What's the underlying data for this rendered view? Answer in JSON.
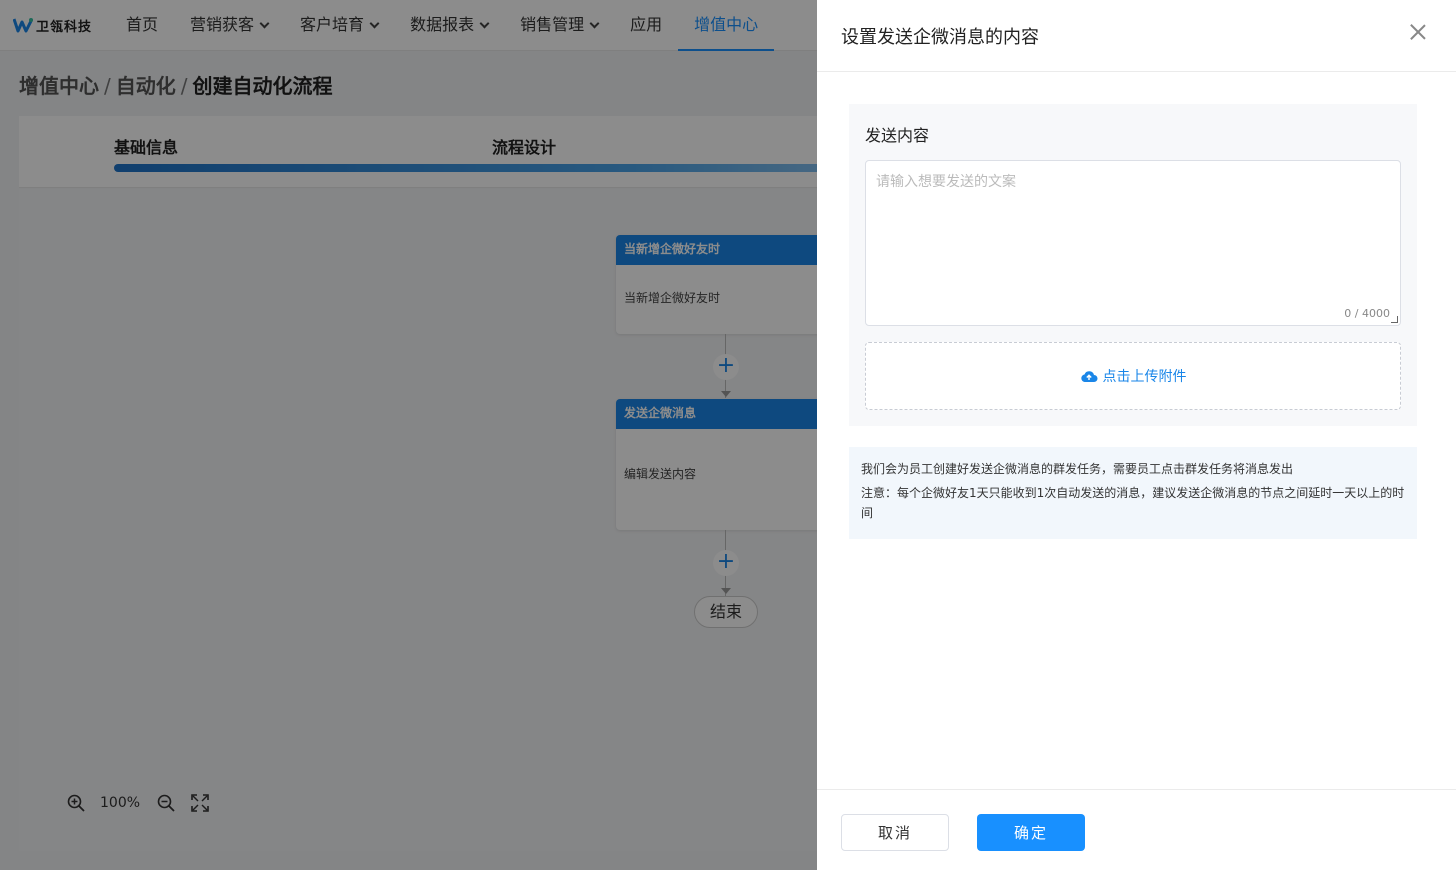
{
  "app": {
    "logo_text": "卫瓴科技"
  },
  "nav": {
    "items": [
      {
        "label": "首页",
        "has_dropdown": false,
        "active": false
      },
      {
        "label": "营销获客",
        "has_dropdown": true,
        "active": false
      },
      {
        "label": "客户培育",
        "has_dropdown": true,
        "active": false
      },
      {
        "label": "数据报表",
        "has_dropdown": true,
        "active": false
      },
      {
        "label": "销售管理",
        "has_dropdown": true,
        "active": false
      },
      {
        "label": "应用",
        "has_dropdown": false,
        "active": false
      },
      {
        "label": "增值中心",
        "has_dropdown": false,
        "active": true
      }
    ]
  },
  "breadcrumb": {
    "items": [
      "增值中心",
      "自动化",
      "创建自动化流程"
    ],
    "separator": "/"
  },
  "steps": {
    "step1": "基础信息",
    "step2": "流程设计"
  },
  "flow": {
    "trigger_node": {
      "title": "当新增企微好友时",
      "body": "当新增企微好友时"
    },
    "action_node": {
      "title": "发送企微消息",
      "body": "编辑发送内容"
    },
    "add_symbol": "+",
    "end_label": "结束"
  },
  "zoom": {
    "value": "100%"
  },
  "drawer": {
    "title": "设置发送企微消息的内容",
    "content_label": "发送内容",
    "textarea": {
      "placeholder": "请输入想要发送的文案",
      "value": "",
      "count": "0 / 4000"
    },
    "upload_label": "点击上传附件",
    "notice_line1": "我们会为员工创建好发送企微消息的群发任务，需要员工点击群发任务将消息发出",
    "notice_line2": "注意：每个企微好友1天只能收到1次自动发送的消息，建议发送企微消息的节点之间延时一天以上的时间",
    "cancel_label": "取消",
    "ok_label": "确定"
  },
  "colors": {
    "primary": "#1890ff",
    "node_header": "#1a86e8",
    "mask": "rgba(0,0,0,0.45)"
  }
}
